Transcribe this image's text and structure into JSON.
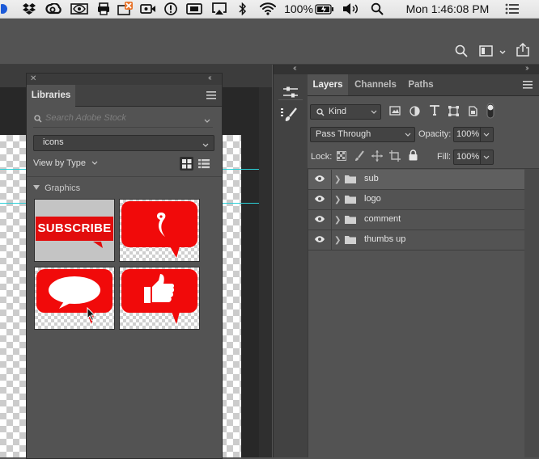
{
  "menubar": {
    "battery_pct": "100%",
    "clock": "Mon 1:46:08 PM",
    "icons": [
      "dropbox-icon",
      "creative-cloud-icon",
      "nvidia-icon",
      "printer-icon",
      "scanner-icon",
      "video-camera-icon",
      "alert-icon",
      "screen-mirror-icon",
      "airplay-icon",
      "bluetooth-icon",
      "wifi-icon",
      "battery-icon",
      "volume-icon",
      "spotlight-icon",
      "notification-center-icon"
    ]
  },
  "libraries": {
    "tab_label": "Libraries",
    "search_placeholder": "Search Adobe Stock",
    "library_select": "icons",
    "view_by": "View by Type",
    "section_title": "Graphics",
    "tiles": [
      {
        "name": "subscribe",
        "text": "SUBSCRIBE"
      },
      {
        "name": "logo"
      },
      {
        "name": "comment"
      },
      {
        "name": "thumbs-up"
      }
    ]
  },
  "layers_panel": {
    "tabs": [
      "Layers",
      "Channels",
      "Paths"
    ],
    "filter_kind": "Kind",
    "blend_mode": "Pass Through",
    "opacity_label": "Opacity:",
    "opacity_value": "100%",
    "lock_label": "Lock:",
    "fill_label": "Fill:",
    "fill_value": "100%",
    "layers": [
      {
        "name": "sub",
        "selected": true
      },
      {
        "name": "logo",
        "selected": false
      },
      {
        "name": "comment",
        "selected": false
      },
      {
        "name": "thumbs up",
        "selected": false
      }
    ]
  },
  "colors": {
    "accent_red": "#f10a0a",
    "guide_cyan": "#2ccfd6",
    "panel_bg": "#535353"
  }
}
